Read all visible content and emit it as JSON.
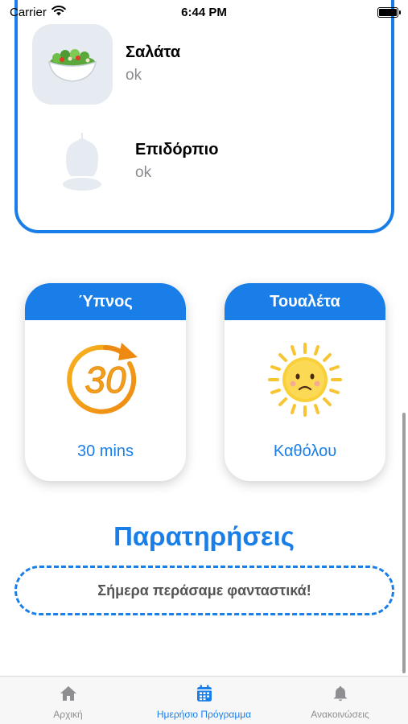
{
  "status_bar": {
    "carrier": "Carrier",
    "time": "6:44 PM",
    "icons": [
      "wifi-icon",
      "battery-icon"
    ]
  },
  "meals": [
    {
      "title": "Σαλάτα",
      "status": "ok",
      "icon": "salad-icon"
    },
    {
      "title": "Επιδόρπιο",
      "status": "ok",
      "icon": "dessert-placeholder-icon"
    }
  ],
  "stats": {
    "sleep": {
      "title": "Ύπνος",
      "value": "30 mins",
      "icon": "timer-30-icon",
      "icon_text": "30"
    },
    "toilet": {
      "title": "Τουαλέτα",
      "value": "Καθόλου",
      "icon": "sad-sun-icon"
    }
  },
  "remarks": {
    "title": "Παρατηρήσεις",
    "text": "Σήμερα περάσαμε φανταστικά!"
  },
  "tab_bar": {
    "tabs": [
      {
        "label": "Αρχική",
        "icon": "home-icon",
        "active": false
      },
      {
        "label": "Ημερήσιο Πρόγραμμα",
        "icon": "calendar-icon",
        "active": true
      },
      {
        "label": "Ανακοινώσεις",
        "icon": "bell-icon",
        "active": false
      }
    ]
  },
  "colors": {
    "accent": "#1a7ee8",
    "timer_orange": "#f2a01b",
    "sun_yellow": "#f7c531"
  }
}
